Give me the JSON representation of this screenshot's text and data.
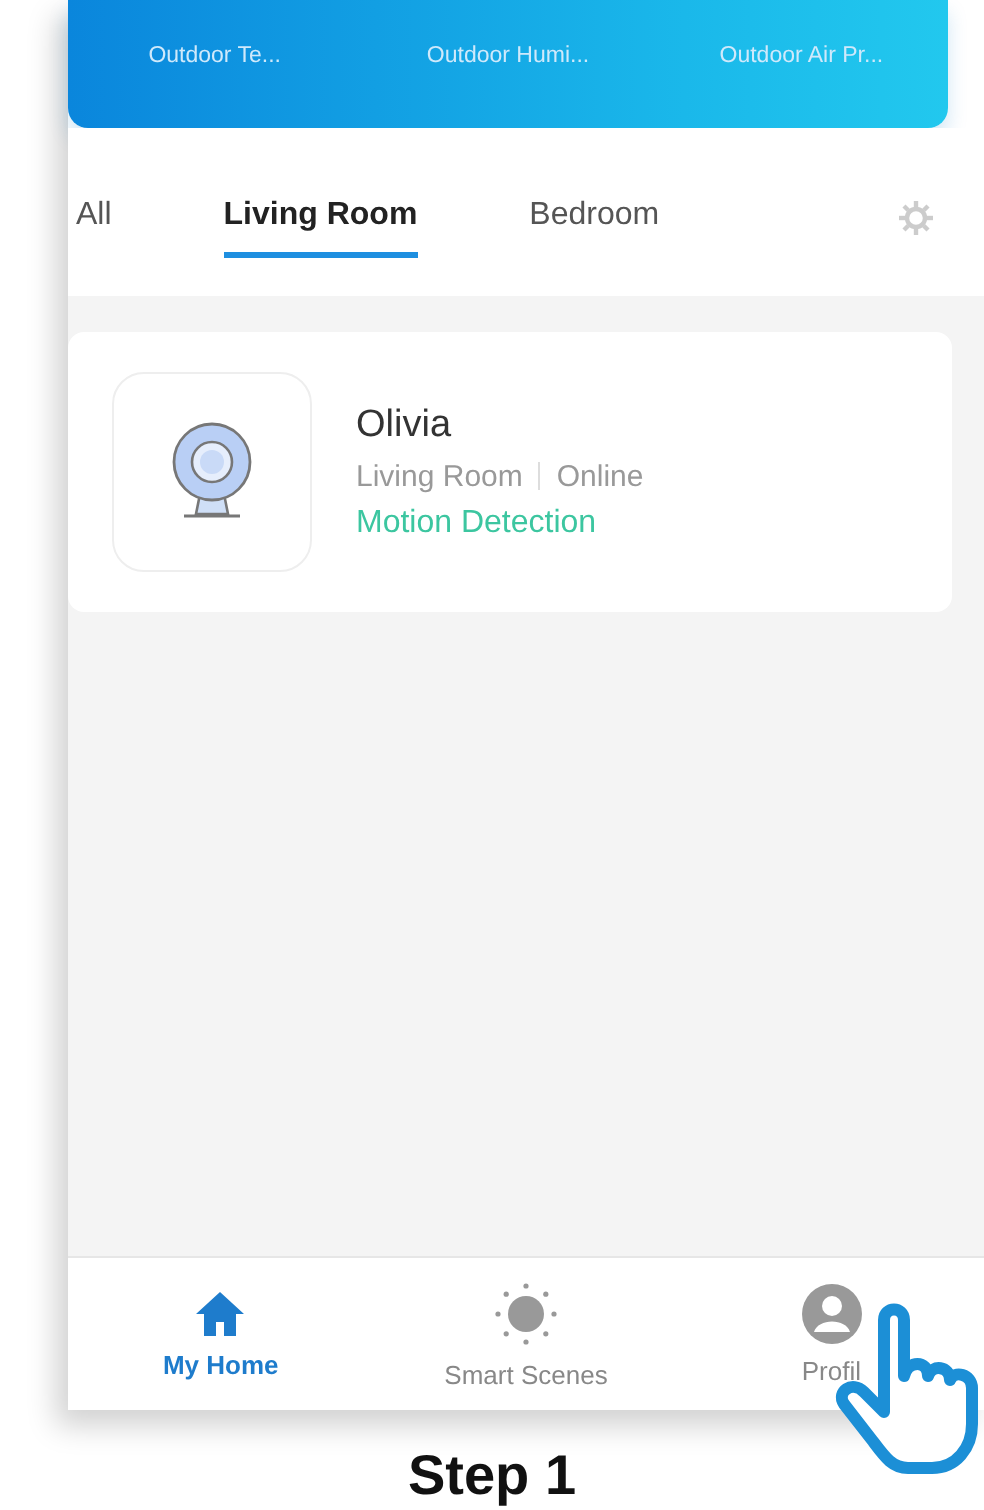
{
  "banner": {
    "stats": [
      {
        "label": "Outdoor Te..."
      },
      {
        "label": "Outdoor Humi..."
      },
      {
        "label": "Outdoor Air Pr..."
      }
    ]
  },
  "tabs": [
    {
      "label": "All",
      "selected": false
    },
    {
      "label": "Living Room",
      "selected": true
    },
    {
      "label": "Bedroom",
      "selected": false
    }
  ],
  "devices": [
    {
      "name": "Olivia",
      "room": "Living Room",
      "status": "Online",
      "mode": "Motion Detection"
    }
  ],
  "nav": [
    {
      "kind": "home",
      "label": "My Home",
      "selected": true
    },
    {
      "kind": "scenes",
      "label": "Smart Scenes",
      "selected": false
    },
    {
      "kind": "profile",
      "label": "Profil",
      "selected": false
    }
  ],
  "caption": "Step 1"
}
